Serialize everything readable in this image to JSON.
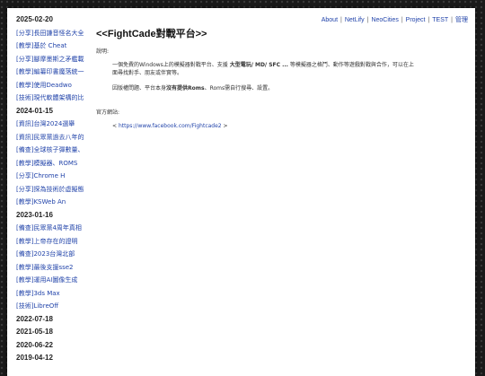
{
  "nav": {
    "links": [
      "About",
      "NetLify",
      "NeoCities",
      "Project",
      "TEST",
      "管理"
    ]
  },
  "sidebar": {
    "items": [
      {
        "type": "date",
        "text": "2025-02-20"
      },
      {
        "type": "post",
        "text": "[分享]長田謙音怪名大全"
      },
      {
        "type": "post",
        "text": "[教學]基於 Cheat"
      },
      {
        "type": "post",
        "text": "[分享]腳摩墨斯之矛艦載"
      },
      {
        "type": "post",
        "text": "[教學]編纂印書魔落統一"
      },
      {
        "type": "post",
        "text": "[教學]使用Deadwo"
      },
      {
        "type": "post",
        "text": "[技術]現代軟體架構的比"
      },
      {
        "type": "date",
        "text": "2024-01-15"
      },
      {
        "type": "post",
        "text": "[資訊]台灣2024選舉"
      },
      {
        "type": "post",
        "text": "[資訊]民眾黨過去八年的"
      },
      {
        "type": "post",
        "text": "[備查]全球核子彈數量、"
      },
      {
        "type": "post",
        "text": "[教學]模擬器、ROMS"
      },
      {
        "type": "post",
        "text": "[分享]Chrome H"
      },
      {
        "type": "post",
        "text": "[分享]探為技術於虛擬態"
      },
      {
        "type": "post",
        "text": "[教學]KSWeb An"
      },
      {
        "type": "date",
        "text": "2023-01-16"
      },
      {
        "type": "post",
        "text": "[備查]民眾黨4周年真相"
      },
      {
        "type": "post",
        "text": "[教學]上帝存在的證明"
      },
      {
        "type": "post",
        "text": "[備查]2023台灣北部"
      },
      {
        "type": "post",
        "text": "[教學]最後支援sse2"
      },
      {
        "type": "post",
        "text": "[教學]運用AI圖像生成"
      },
      {
        "type": "post",
        "text": "[教學]3ds Max"
      },
      {
        "type": "post",
        "text": "[技術]LibreOff"
      },
      {
        "type": "date",
        "text": "2022-07-18"
      },
      {
        "type": "date",
        "text": "2021-05-18"
      },
      {
        "type": "date",
        "text": "2020-06-22"
      },
      {
        "type": "date",
        "text": "2019-04-12"
      }
    ]
  },
  "article": {
    "title": "<<FightCade對戰平台>>",
    "heading1": "說明:",
    "desc_line1_a": "一個免費的Windows上的模擬器對戰平台、支援 ",
    "desc_line1_b": "大型電玩/ MD/ SFC ...",
    "desc_line1_c": " 等模擬器之格鬥、動作等遊戲對戰與合作，可以在上",
    "desc_line2": "面尋找對手、朋友或伴實等。",
    "note_a": "因版權問題、平台本身",
    "note_b": "沒有提供Roms",
    "note_c": "、Roms需自行搜尋、設置。",
    "heading2": "官方網站:",
    "link_prefix": "< ",
    "link_text": "https://www.facebook.com/Fightcade2",
    "link_suffix": " >"
  }
}
